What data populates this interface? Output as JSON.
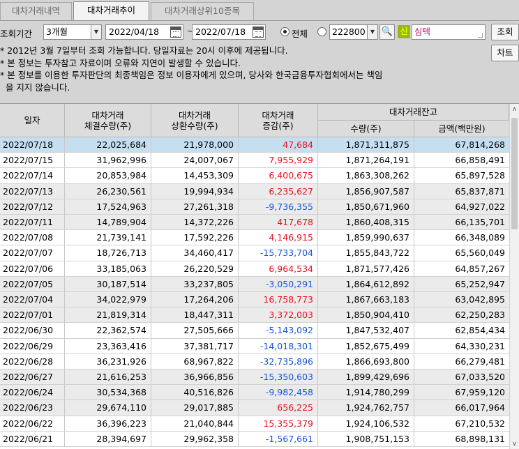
{
  "tabs": [
    {
      "label": "대차거래내역"
    },
    {
      "label": "대차거래추이"
    },
    {
      "label": "대차거래상위10종목"
    }
  ],
  "filter": {
    "period_label": "조회기간",
    "period_value": "3개월",
    "start_date": "2022/04/18",
    "date_separator": "~",
    "end_date": "2022/07/18",
    "radio_all_label": "전체",
    "code_value": "222800",
    "search_icon": "🔍",
    "new_badge": "신",
    "stock_name": "심텍",
    "query_button": "조회",
    "chart_button": "차트"
  },
  "notices": [
    "* 2012년 3월 7일부터 조회 가능합니다. 당일자료는 20시 이후에 제공됩니다.",
    "* 본 정보는 투자참고 자료이며 오류와 지연이 발생할 수 있습니다.",
    "* 본 정보를 이용한 투자판단의 최종책임은 정보 이용자에게 있으며, 당사와 한국금융투자협회에서는 책임",
    "  을 지지 않습니다."
  ],
  "table": {
    "headers": {
      "date": "일자",
      "exec": [
        "대차거래",
        "체결수량(주)"
      ],
      "repay": [
        "대차거래",
        "상환수량(주)"
      ],
      "change": [
        "대차거래",
        "증감(주)"
      ],
      "balance": "대차거래잔고",
      "qty": "수량(주)",
      "amount": "금액(백만원)"
    },
    "rows": [
      {
        "date": "2022/07/18",
        "exec": "22,025,684",
        "repay": "21,978,000",
        "change": "47,684",
        "sign": "pos",
        "qty": "1,871,311,875",
        "amount": "67,814,268"
      },
      {
        "date": "2022/07/15",
        "exec": "31,962,996",
        "repay": "24,007,067",
        "change": "7,955,929",
        "sign": "pos",
        "qty": "1,871,264,191",
        "amount": "66,858,491"
      },
      {
        "date": "2022/07/14",
        "exec": "20,853,984",
        "repay": "14,453,309",
        "change": "6,400,675",
        "sign": "pos",
        "qty": "1,863,308,262",
        "amount": "65,897,528"
      },
      {
        "date": "2022/07/13",
        "exec": "26,230,561",
        "repay": "19,994,934",
        "change": "6,235,627",
        "sign": "pos",
        "qty": "1,856,907,587",
        "amount": "65,837,871"
      },
      {
        "date": "2022/07/12",
        "exec": "17,524,963",
        "repay": "27,261,318",
        "change": "-9,736,355",
        "sign": "neg",
        "qty": "1,850,671,960",
        "amount": "64,927,022"
      },
      {
        "date": "2022/07/11",
        "exec": "14,789,904",
        "repay": "14,372,226",
        "change": "417,678",
        "sign": "pos",
        "qty": "1,860,408,315",
        "amount": "66,135,701"
      },
      {
        "date": "2022/07/08",
        "exec": "21,739,141",
        "repay": "17,592,226",
        "change": "4,146,915",
        "sign": "pos",
        "qty": "1,859,990,637",
        "amount": "66,348,089"
      },
      {
        "date": "2022/07/07",
        "exec": "18,726,713",
        "repay": "34,460,417",
        "change": "-15,733,704",
        "sign": "neg",
        "qty": "1,855,843,722",
        "amount": "65,560,049"
      },
      {
        "date": "2022/07/06",
        "exec": "33,185,063",
        "repay": "26,220,529",
        "change": "6,964,534",
        "sign": "pos",
        "qty": "1,871,577,426",
        "amount": "64,857,267"
      },
      {
        "date": "2022/07/05",
        "exec": "30,187,514",
        "repay": "33,237,805",
        "change": "-3,050,291",
        "sign": "neg",
        "qty": "1,864,612,892",
        "amount": "65,252,947"
      },
      {
        "date": "2022/07/04",
        "exec": "34,022,979",
        "repay": "17,264,206",
        "change": "16,758,773",
        "sign": "pos",
        "qty": "1,867,663,183",
        "amount": "63,042,895"
      },
      {
        "date": "2022/07/01",
        "exec": "21,819,314",
        "repay": "18,447,311",
        "change": "3,372,003",
        "sign": "pos",
        "qty": "1,850,904,410",
        "amount": "62,250,283"
      },
      {
        "date": "2022/06/30",
        "exec": "22,362,574",
        "repay": "27,505,666",
        "change": "-5,143,092",
        "sign": "neg",
        "qty": "1,847,532,407",
        "amount": "62,854,434"
      },
      {
        "date": "2022/06/29",
        "exec": "23,363,416",
        "repay": "37,381,717",
        "change": "-14,018,301",
        "sign": "neg",
        "qty": "1,852,675,499",
        "amount": "64,330,231"
      },
      {
        "date": "2022/06/28",
        "exec": "36,231,926",
        "repay": "68,967,822",
        "change": "-32,735,896",
        "sign": "neg",
        "qty": "1,866,693,800",
        "amount": "66,279,481"
      },
      {
        "date": "2022/06/27",
        "exec": "21,616,253",
        "repay": "36,966,856",
        "change": "-15,350,603",
        "sign": "neg",
        "qty": "1,899,429,696",
        "amount": "67,033,520"
      },
      {
        "date": "2022/06/24",
        "exec": "30,534,368",
        "repay": "40,516,826",
        "change": "-9,982,458",
        "sign": "neg",
        "qty": "1,914,780,299",
        "amount": "67,959,120"
      },
      {
        "date": "2022/06/23",
        "exec": "29,674,110",
        "repay": "29,017,885",
        "change": "656,225",
        "sign": "pos",
        "qty": "1,924,762,757",
        "amount": "66,017,964"
      },
      {
        "date": "2022/06/22",
        "exec": "36,396,223",
        "repay": "21,040,844",
        "change": "15,355,379",
        "sign": "pos",
        "qty": "1,924,106,532",
        "amount": "67,210,532"
      },
      {
        "date": "2022/06/21",
        "exec": "28,394,697",
        "repay": "29,962,358",
        "change": "-1,567,661",
        "sign": "neg",
        "qty": "1,908,751,153",
        "amount": "68,898,131"
      }
    ]
  },
  "colors": {
    "positive": "#e8101b",
    "negative": "#1655d8",
    "selected_row": "#c5dff0"
  }
}
